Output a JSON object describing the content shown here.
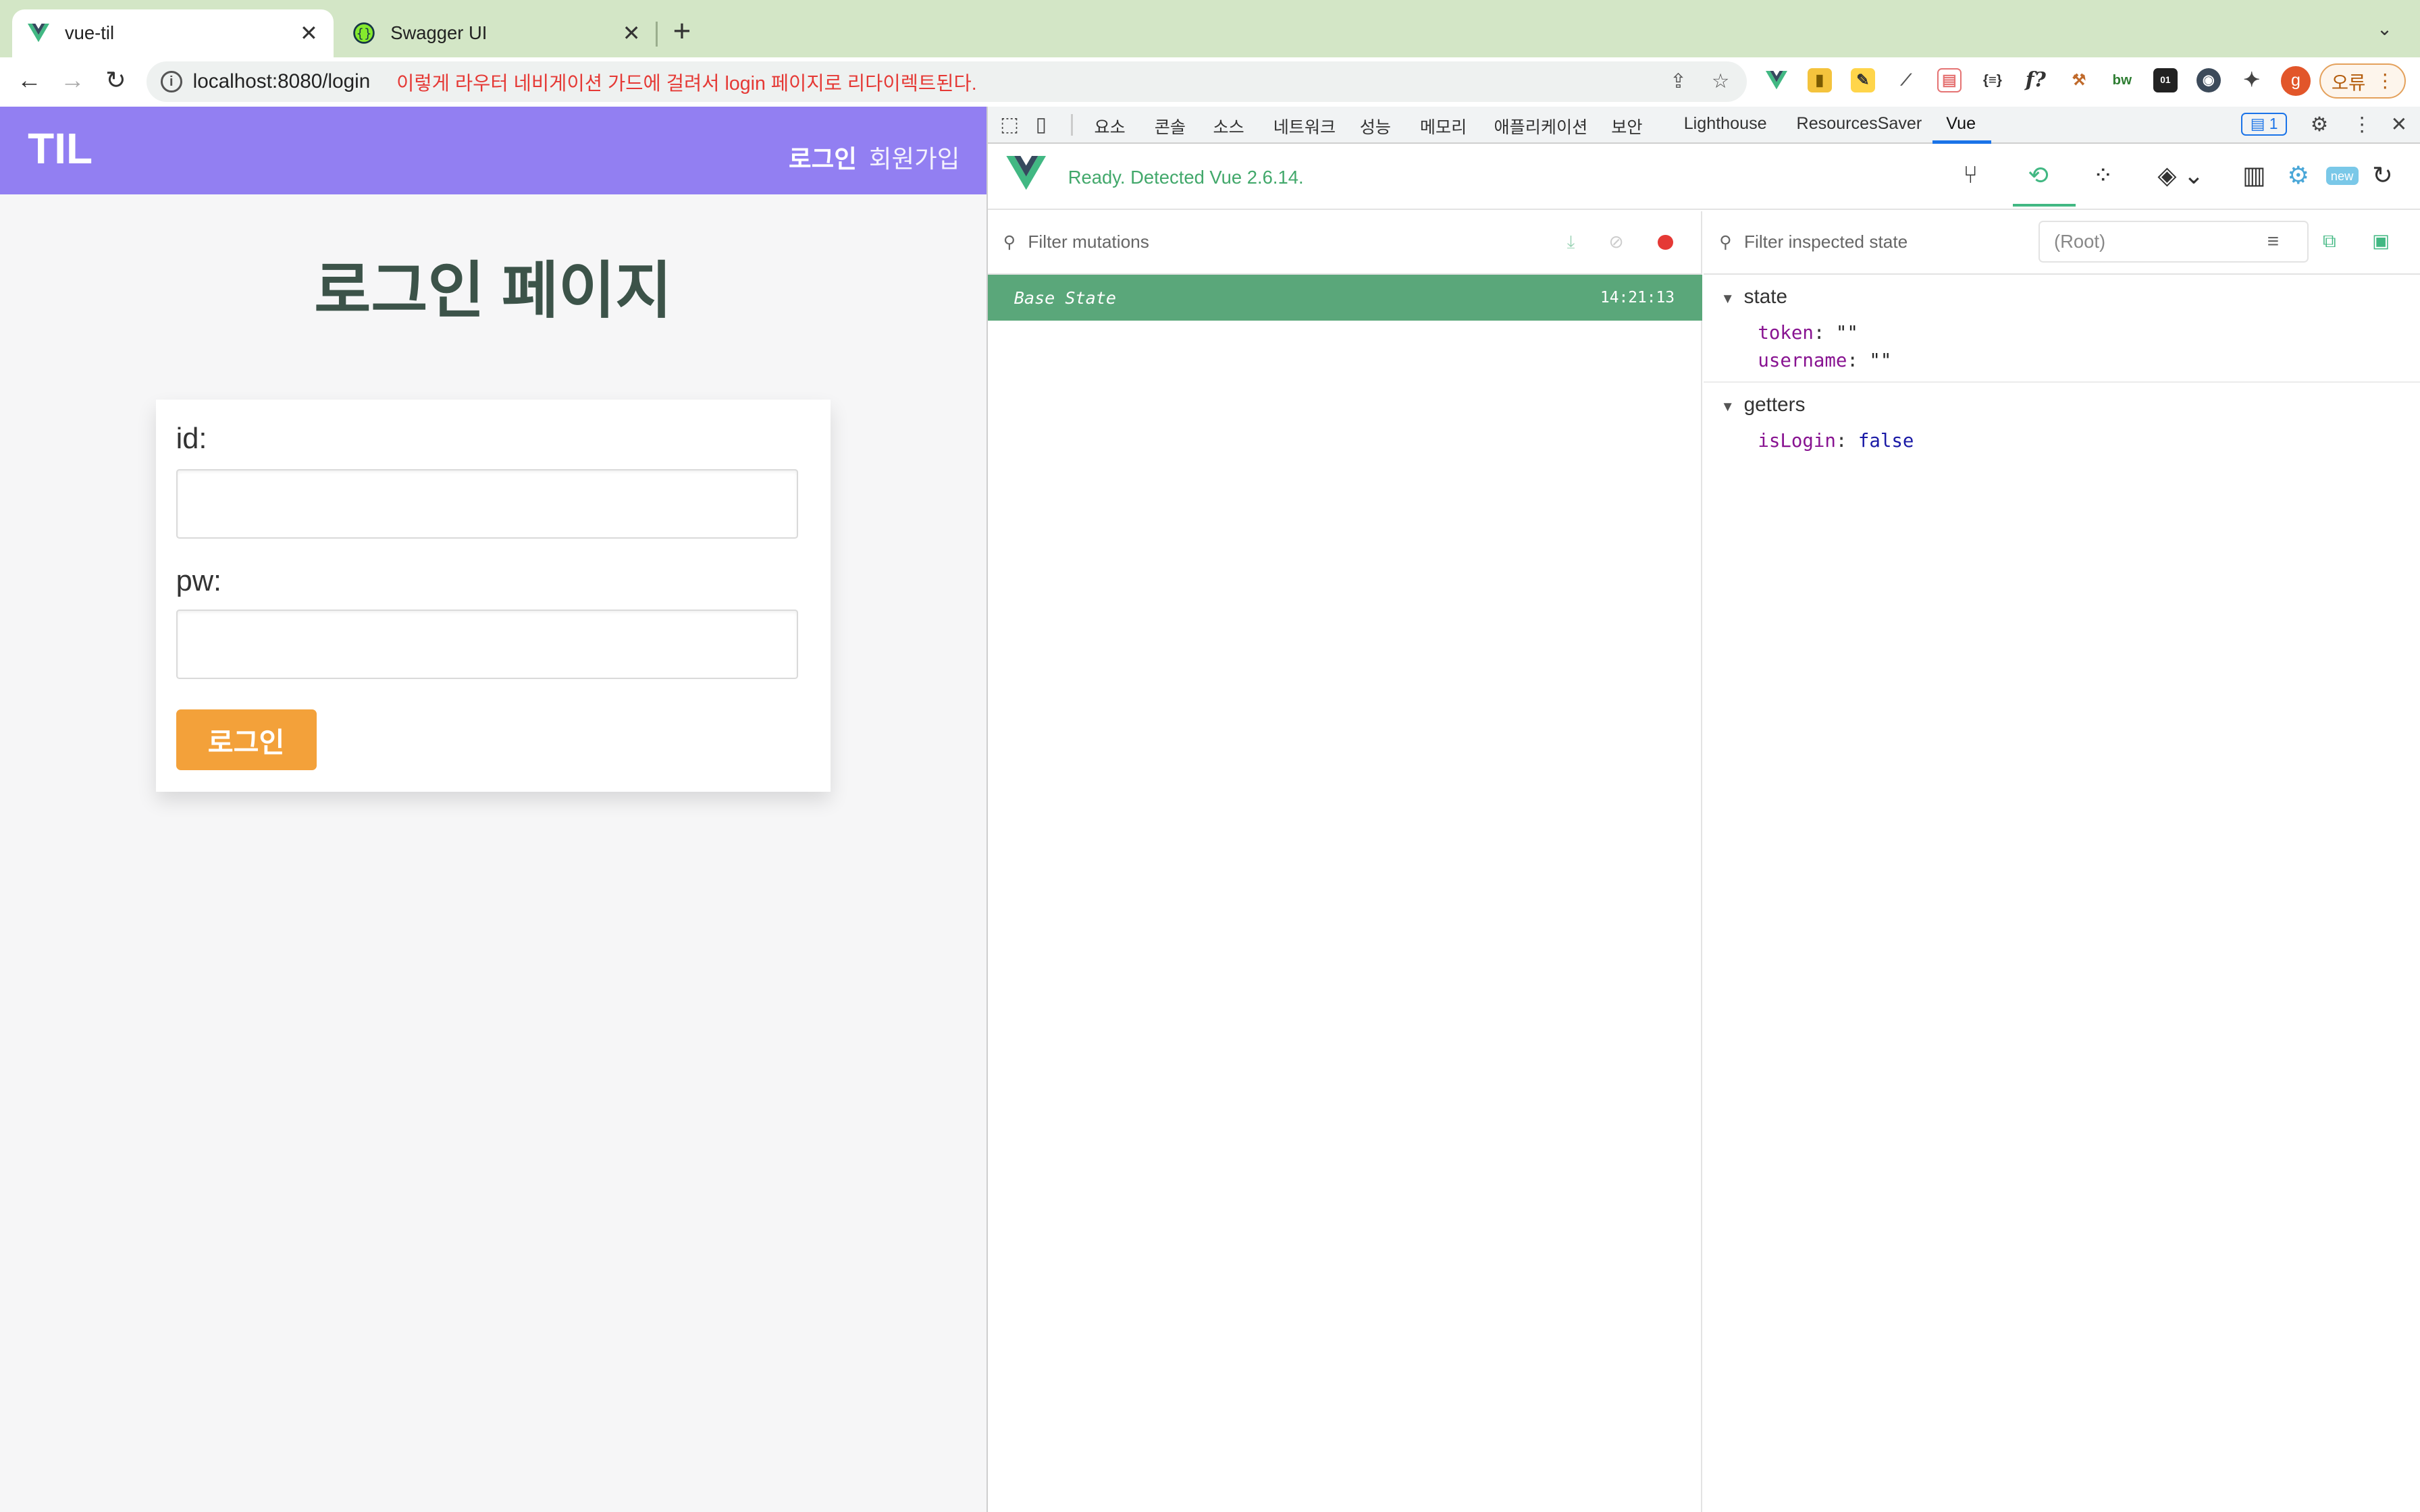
{
  "browser": {
    "tabs": [
      {
        "title": "vue-til",
        "active": true,
        "icon": "vue-logo-icon"
      },
      {
        "title": "Swagger UI",
        "active": false,
        "icon": "swagger-icon"
      }
    ],
    "url": "localhost:8080/login",
    "annotation": "이렇게 라우터 네비게이션 가드에 걸려서 login 페이지로 리다이렉트된다.",
    "profile_initial": "g",
    "error_label": "오류",
    "annotation_color": "#e53935"
  },
  "app": {
    "brand": "TIL",
    "nav": {
      "login": "로그인",
      "signup": "회원가입"
    },
    "page_title": "로그인 페이지",
    "form": {
      "id_label": "id:",
      "id_value": "",
      "pw_label": "pw:",
      "pw_value": "",
      "submit_label": "로그인"
    },
    "header_color": "#927ff2",
    "button_color": "#f3a13a"
  },
  "devtools": {
    "tabs": [
      "요소",
      "콘솔",
      "소스",
      "네트워크",
      "성능",
      "메모리",
      "애플리케이션",
      "보안",
      "Lighthouse",
      "ResourcesSaver",
      "Vue"
    ],
    "active_tab": "Vue",
    "issues_count": "1",
    "vue": {
      "status": "Ready. Detected Vue 2.6.14.",
      "mutations_filter_placeholder": "Filter mutations",
      "state_filter_placeholder": "Filter inspected state",
      "root_selector": "(Root)",
      "mutations": [
        {
          "name": "Base State",
          "time": "14:21:13"
        }
      ],
      "state_section": "state",
      "state": [
        {
          "key": "token",
          "value": "\"\""
        },
        {
          "key": "username",
          "value": "\"\""
        }
      ],
      "getters_section": "getters",
      "getters": [
        {
          "key": "isLogin",
          "value": "false"
        }
      ],
      "accent_color": "#42b883"
    }
  }
}
